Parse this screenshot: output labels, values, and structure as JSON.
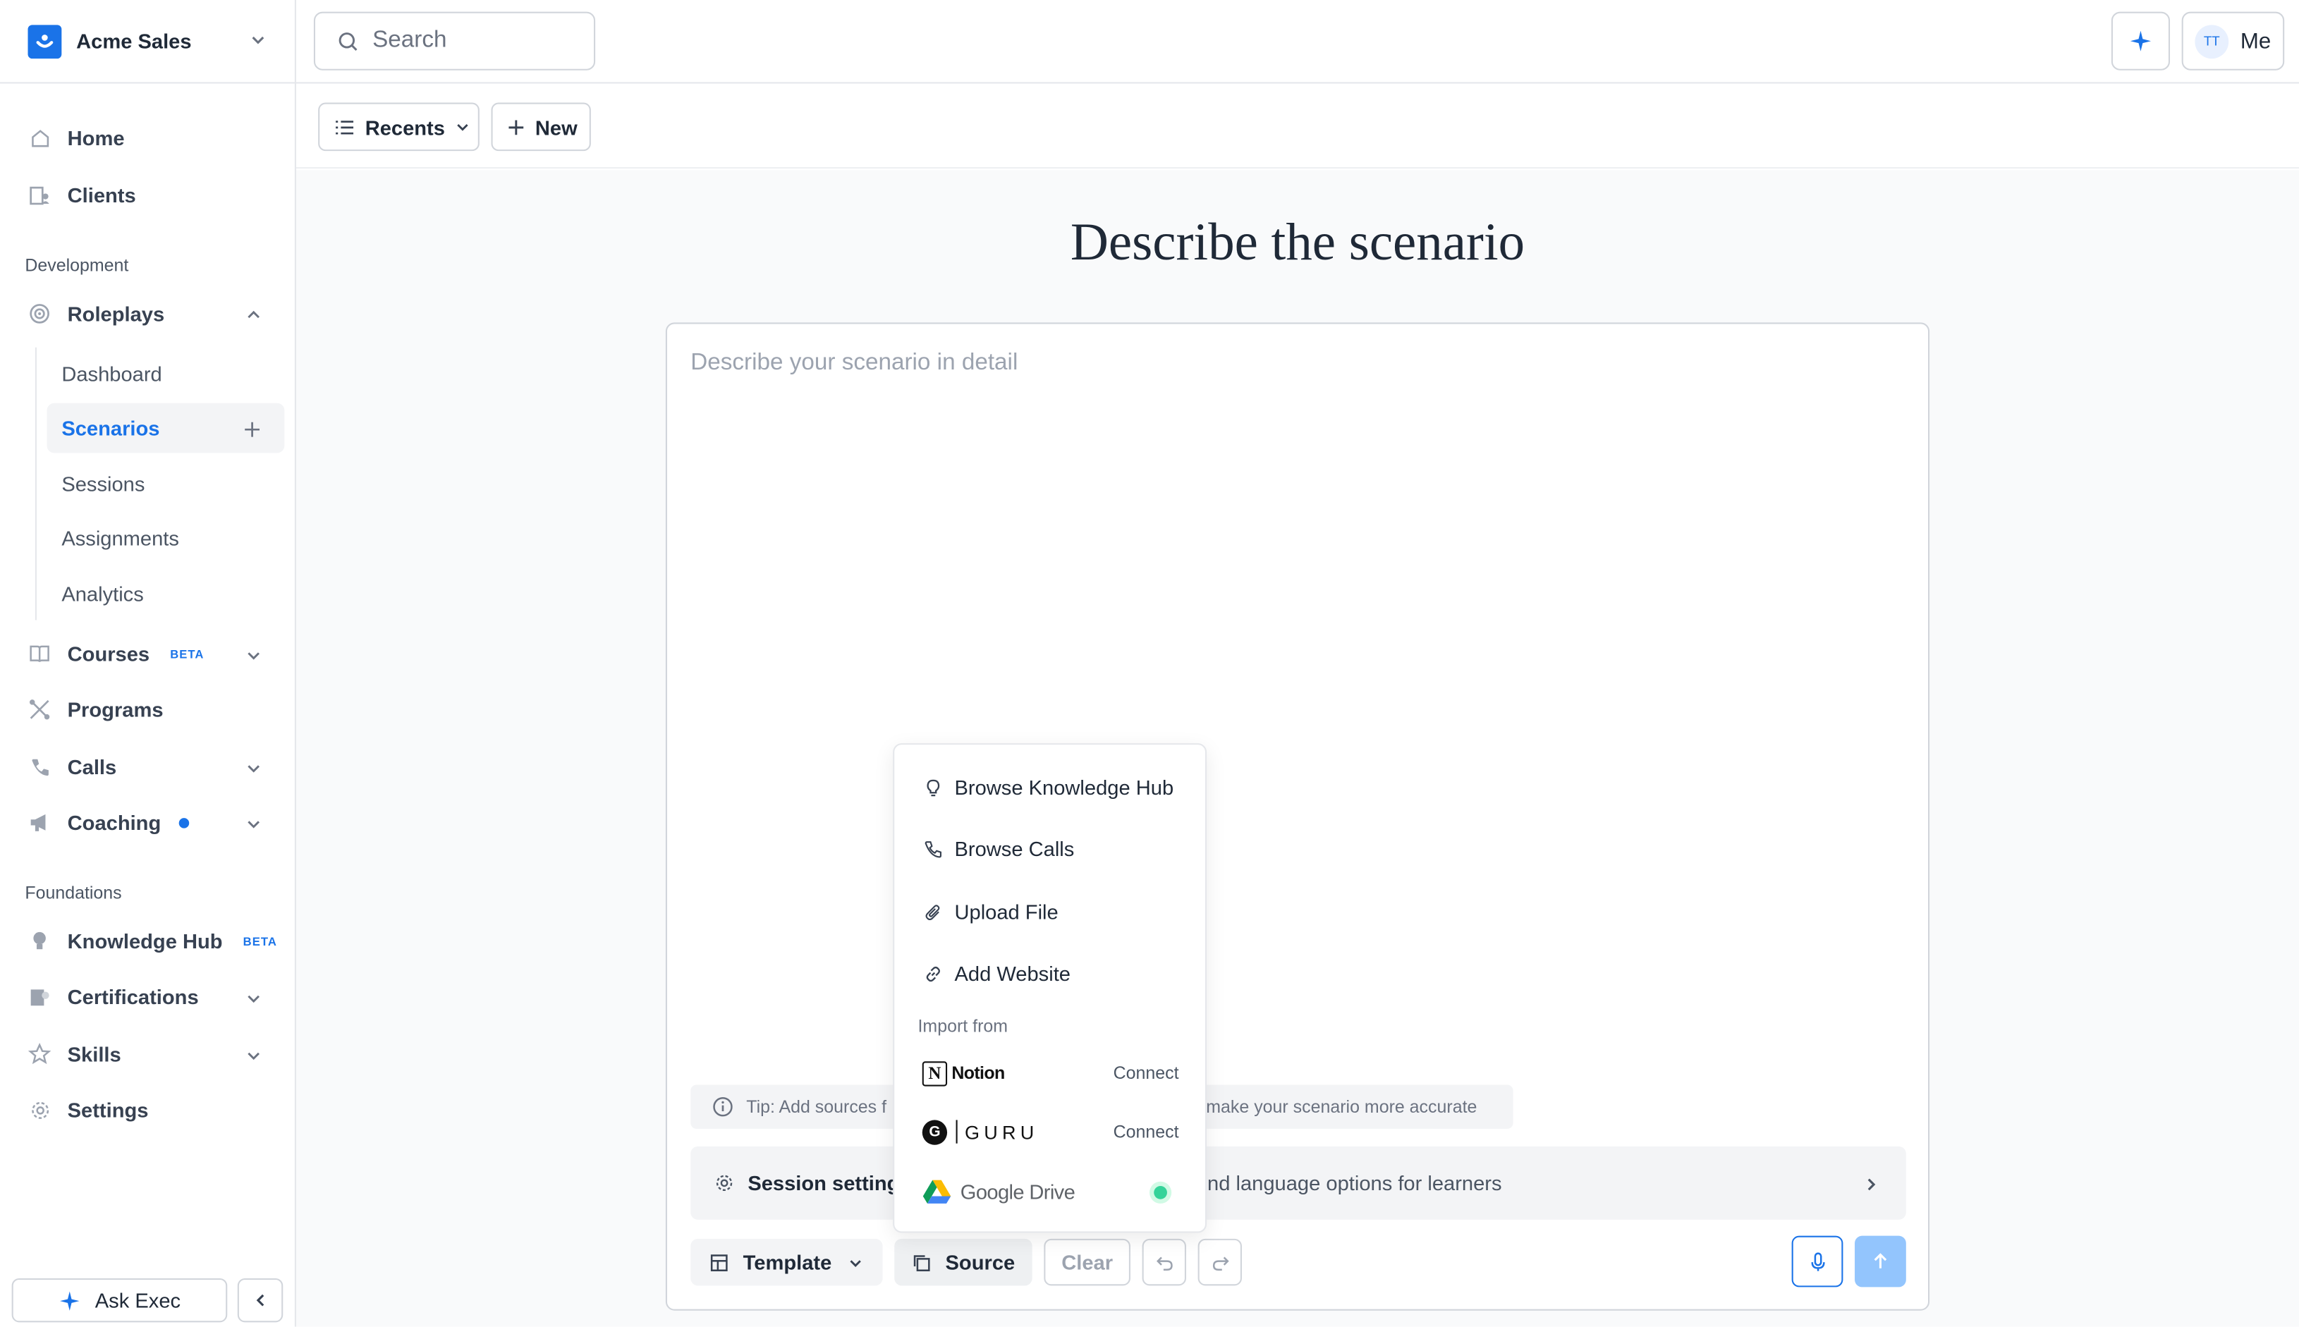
{
  "org": {
    "name": "Acme Sales"
  },
  "nav": {
    "home": "Home",
    "clients": "Clients",
    "development_label": "Development",
    "roleplays": "Roleplays",
    "sub": [
      "Dashboard",
      "Scenarios",
      "Sessions",
      "Assignments",
      "Analytics"
    ],
    "courses": "Courses",
    "courses_badge": "BETA",
    "programs": "Programs",
    "calls": "Calls",
    "coaching": "Coaching",
    "foundations_label": "Foundations",
    "knowledge_hub": "Knowledge Hub",
    "knowledge_badge": "BETA",
    "certifications": "Certifications",
    "skills": "Skills",
    "settings": "Settings"
  },
  "footer": {
    "ask_exec": "Ask Exec"
  },
  "topbar": {
    "search_placeholder": "Search",
    "avatar_initials": "TT",
    "me_label": "Me"
  },
  "toolbar": {
    "recents": "Recents",
    "new": "New"
  },
  "main": {
    "heading": "Describe the scenario",
    "placeholder": "Describe your scenario in detail",
    "tip": "Tip: Add sources f",
    "tip_tail": "make your scenario more accurate",
    "session_settings": "Session setting",
    "session_desc": "nd language options for learners"
  },
  "editor_buttons": {
    "template": "Template",
    "source": "Source",
    "clear": "Clear"
  },
  "source_menu": {
    "items": [
      "Browse Knowledge Hub",
      "Browse Calls",
      "Upload File",
      "Add Website"
    ],
    "import_label": "Import from",
    "notion": "Notion",
    "guru": "GURU",
    "google_drive": "Google Drive",
    "connect": "Connect"
  },
  "colors": {
    "accent": "#1a73e8",
    "send_disabled": "#93c5fd",
    "connected": "#34d399"
  }
}
